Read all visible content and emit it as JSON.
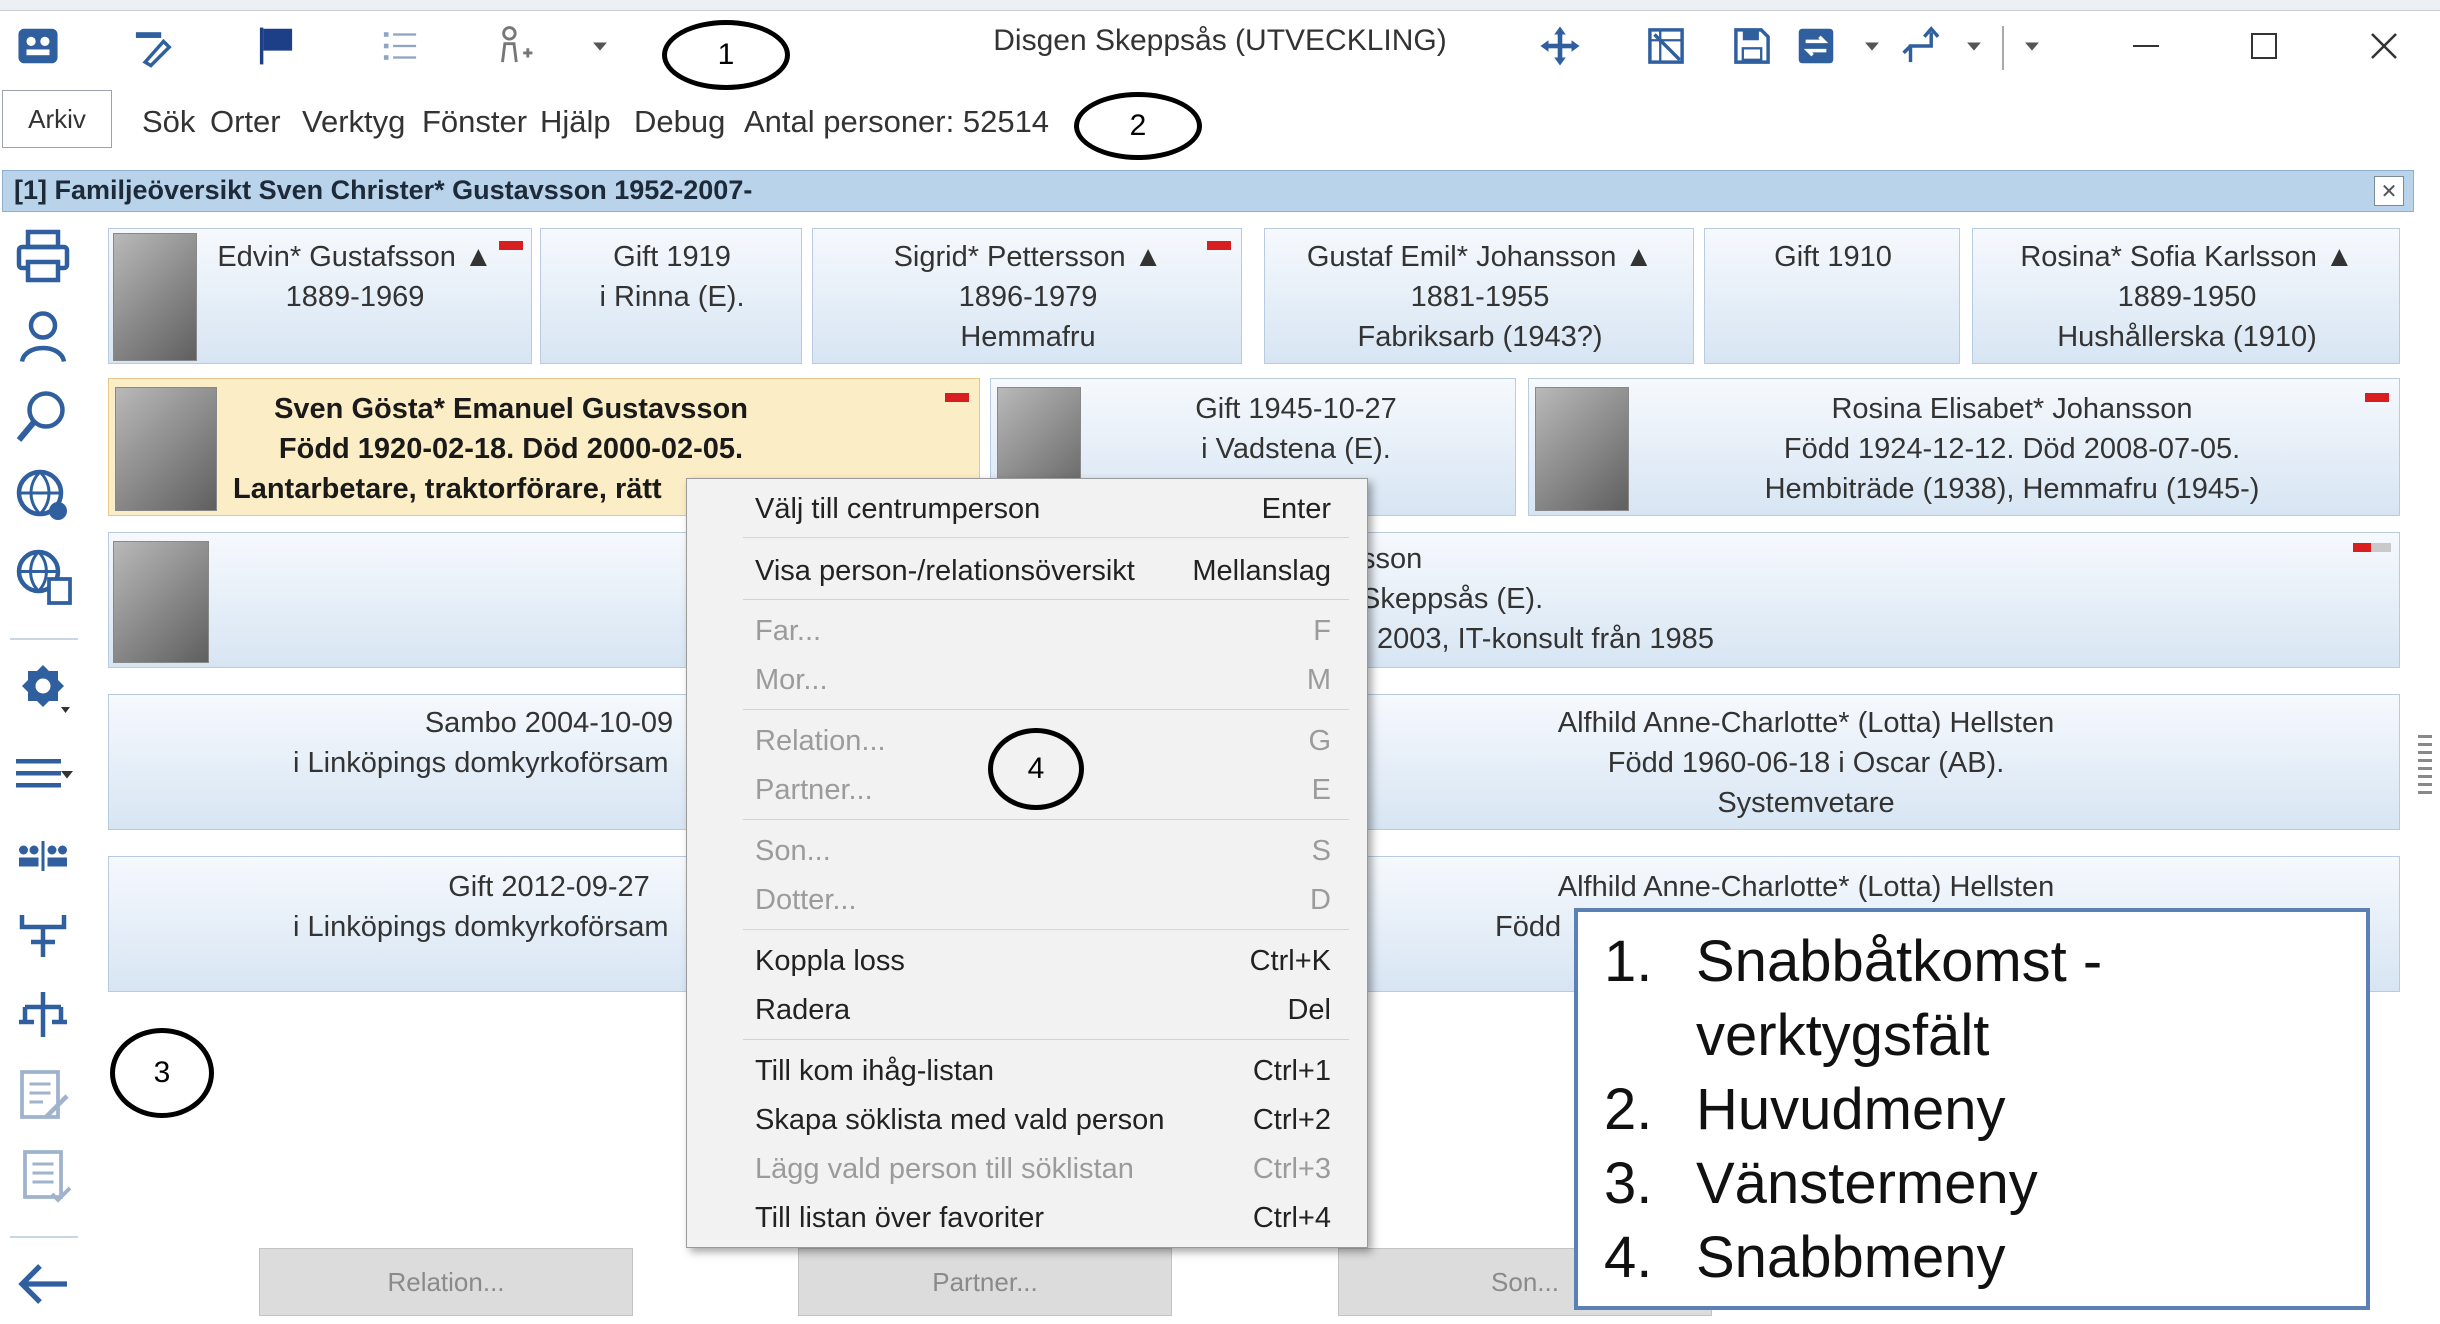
{
  "window": {
    "title": "Disgen Skeppsås (UTVECKLING)",
    "close_glyph": "✕",
    "maximize_glyph": "☐",
    "minimize_glyph": "—"
  },
  "menubar": {
    "arkiv": "Arkiv",
    "items": [
      "Sök",
      "Orter",
      "Verktyg",
      "Fönster",
      "Hjälp",
      "Debug",
      "Antal personer: 52514"
    ]
  },
  "family_window": {
    "header": "[1] Familjeöversikt Sven Christer* Gustavsson 1952-2007-",
    "close_glyph": "✕"
  },
  "grandparents": {
    "paternal_grandfather": {
      "line1": "Edvin* Gustafsson ▲",
      "line2": "1889-1969"
    },
    "paternal_marriage": {
      "line1": "Gift 1919",
      "line2": "i Rinna (E)."
    },
    "paternal_grandmother": {
      "line1": "Sigrid* Pettersson ▲",
      "line2": "1896-1979",
      "line3": "Hemmafru"
    },
    "maternal_grandfather": {
      "line1": "Gustaf Emil* Johansson ▲",
      "line2": "1881-1955",
      "line3": "Fabriksarb (1943?)"
    },
    "maternal_marriage": {
      "line1": "Gift 1910"
    },
    "maternal_grandmother": {
      "line1": "Rosina* Sofia Karlsson ▲",
      "line2": "1889-1950",
      "line3": "Hushållerska (1910)"
    }
  },
  "parents": {
    "father": {
      "line1": "Sven Gösta* Emanuel Gustavsson",
      "line2": "Född 1920-02-18. Död 2000-02-05.",
      "line3": "Lantarbetare, traktorförare, rätt"
    },
    "marriage": {
      "line1": "Gift 1945-10-27",
      "line2": "i Vadstena (E)."
    },
    "mother": {
      "line1": "Rosina Elisabet* Johansson",
      "line2": "Född 1924-12-12. Död 2008-07-05.",
      "line3": "Hembiträde (1938), Hemmafru (1945-)"
    }
  },
  "main_person": {
    "line1": "sson",
    "line2": "Skeppsås (E).",
    "line3": "2003, IT-konsult från 1985"
  },
  "relations": [
    {
      "event_line1": "Sambo 2004-10-09",
      "event_line2": "i Linköpings domkyrkoförsam",
      "partner_line1": "Alfhild Anne-Charlotte* (Lotta) Hellsten",
      "partner_line2": "Född 1960-06-18 i Oscar (AB).",
      "partner_line3": "Systemvetare"
    },
    {
      "event_line1": "Gift 2012-09-27",
      "event_line2": "i Linköpings domkyrkoförsam",
      "partner_line1": "Alfhild Anne-Charlotte* (Lotta) Hellsten",
      "partner_line2": "Född"
    }
  ],
  "bottom_buttons": [
    "Relation...",
    "Partner...",
    "Son..."
  ],
  "context_menu": {
    "items": [
      {
        "label": "Välj till centrumperson",
        "shortcut": "Enter",
        "enabled": true
      },
      {
        "label": "Visa person-/relationsöversikt",
        "shortcut": "Mellanslag",
        "enabled": true
      },
      {
        "label": "Far...",
        "shortcut": "F",
        "enabled": false
      },
      {
        "label": "Mor...",
        "shortcut": "M",
        "enabled": false
      },
      {
        "label": "Relation...",
        "shortcut": "G",
        "enabled": false
      },
      {
        "label": "Partner...",
        "shortcut": "E",
        "enabled": false
      },
      {
        "label": "Son...",
        "shortcut": "S",
        "enabled": false
      },
      {
        "label": "Dotter...",
        "shortcut": "D",
        "enabled": false
      },
      {
        "label": "Koppla loss",
        "shortcut": "Ctrl+K",
        "enabled": true
      },
      {
        "label": "Radera",
        "shortcut": "Del",
        "enabled": true
      },
      {
        "label": "Till kom ihåg-listan",
        "shortcut": "Ctrl+1",
        "enabled": true
      },
      {
        "label": "Skapa söklista med vald person",
        "shortcut": "Ctrl+2",
        "enabled": true
      },
      {
        "label": "Lägg vald person till söklistan",
        "shortcut": "Ctrl+3",
        "enabled": false
      },
      {
        "label": "Till listan över favoriter",
        "shortcut": "Ctrl+4",
        "enabled": true
      }
    ]
  },
  "annotations": {
    "circle_1": "1",
    "circle_2": "2",
    "circle_3": "3",
    "circle_4": "4",
    "legend": [
      {
        "num": "1.",
        "line1": "Snabbåtkomst -",
        "line2": "verktygsfält"
      },
      {
        "num": "2.",
        "line1": "Huvudmeny"
      },
      {
        "num": "3.",
        "line1": "Vänstermeny"
      },
      {
        "num": "4.",
        "line1": "Snabbmeny"
      }
    ]
  },
  "icons": {
    "quick_access": [
      "app-logo-icon",
      "edit-pen-icon",
      "flag-icon",
      "list-icon",
      "add-person-icon",
      "dropdown-arrow-icon",
      "move-icon",
      "grid-delete-icon",
      "save-icon",
      "swap-icon",
      "dropdown-arrow-icon",
      "route-icon",
      "dropdown-arrow-icon",
      "customize-dropdown-icon"
    ],
    "sidebar": [
      "print-icon",
      "person-icon",
      "search-icon",
      "globe-pin-icon",
      "globe-list-icon",
      "settings-gear-icon",
      "menu-lines-icon",
      "family-pair-icon",
      "tree-down-icon",
      "tree-up-icon",
      "note-edit-icon",
      "note-list-icon",
      "back-arrow-icon"
    ]
  },
  "colors": {
    "accent_blue": "#2f5f9e",
    "card_gradient_top": "#f6f9fd",
    "card_gradient_bottom": "#d7e5f3",
    "center_card": "#fbedc5",
    "header_blue": "#b9d3ea",
    "status_red": "#d81e1e"
  }
}
